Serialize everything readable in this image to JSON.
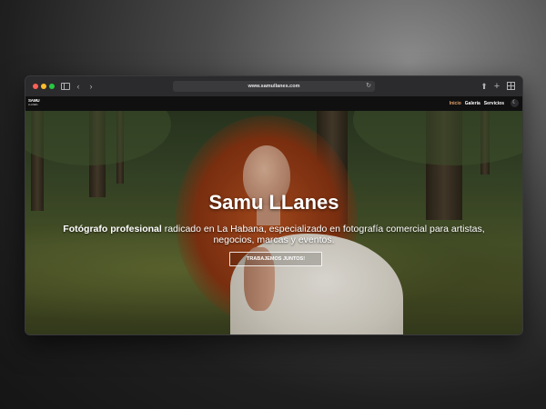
{
  "browser": {
    "url": "www.samullanes.com",
    "icons": [
      "sidebar-icon",
      "back-icon",
      "forward-icon",
      "reload-icon",
      "share-icon",
      "new-tab-icon",
      "tabs-overview-icon"
    ]
  },
  "site": {
    "logo_line1": "SAMU",
    "logo_line2": "LLANES",
    "nav": [
      "Inicio",
      "Galería",
      "Servicios"
    ],
    "active_nav": "Inicio",
    "accent_color": "#e3a26b"
  },
  "hero": {
    "title": "Samu LLanes",
    "desc_bold": "Fotógrafo profesional",
    "desc_rest": " radicado en La Habana, especializado en fotografía comercial para artistas, negocios, marcas y eventos.",
    "cta": "TRABAJEMOS JUNTOS!"
  }
}
